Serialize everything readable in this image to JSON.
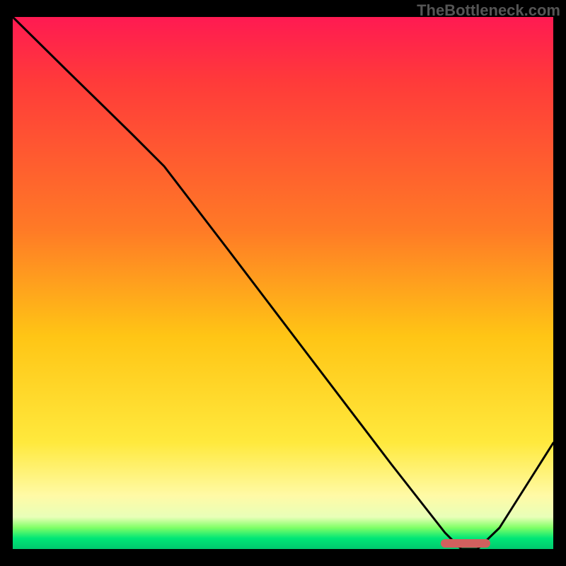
{
  "watermark": "TheBottleneck.com",
  "chart_data": {
    "type": "line",
    "title": "",
    "xlabel": "",
    "ylabel": "",
    "xlim": [
      0,
      100
    ],
    "ylim": [
      0,
      100
    ],
    "grid": false,
    "legend": false,
    "background_gradient": [
      "#ff1a52",
      "#ff7a26",
      "#ffe93d",
      "#00c86e"
    ],
    "series": [
      {
        "name": "bottleneck-curve",
        "color": "#000000",
        "x": [
          0,
          10,
          22,
          28,
          40,
          55,
          70,
          80,
          83,
          86,
          90,
          100
        ],
        "y": [
          100,
          90,
          78,
          72,
          56,
          36,
          16,
          3,
          0,
          0,
          4,
          20
        ]
      }
    ],
    "optimal_marker": {
      "x_start": 80,
      "x_end": 88,
      "y": 0,
      "color": "#d1605e"
    }
  }
}
